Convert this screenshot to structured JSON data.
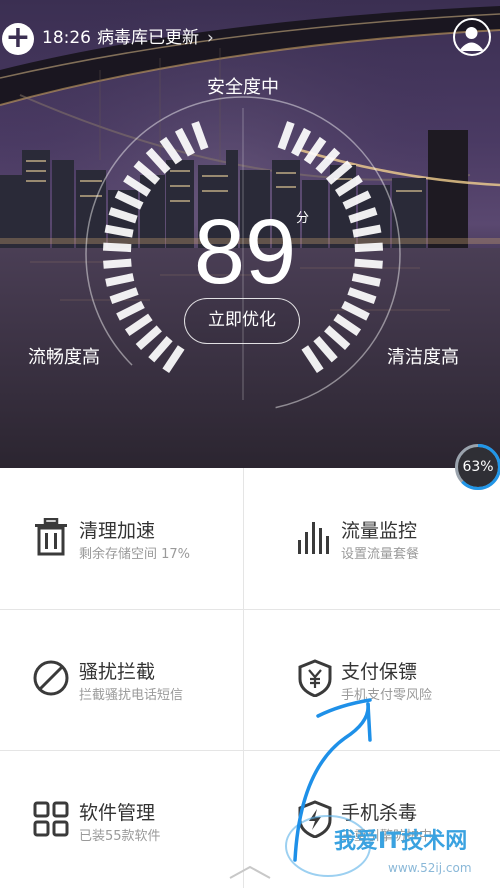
{
  "status": {
    "time": "18:26",
    "message": "病毒库已更新",
    "chevron": "›"
  },
  "hero": {
    "safety_label": "安全度中",
    "score": "89",
    "score_unit": "分",
    "optimize_label": "立即优化",
    "left_label": "流畅度高",
    "right_label": "清洁度高",
    "memory_badge": "63%"
  },
  "tiles": [
    {
      "title": "清理加速",
      "subtitle": "剩余存储空间 17%",
      "icon": "trash-icon"
    },
    {
      "title": "流量监控",
      "subtitle": "设置流量套餐",
      "icon": "bars-icon"
    },
    {
      "title": "骚扰拦截",
      "subtitle": "拦截骚扰电话短信",
      "icon": "block-icon"
    },
    {
      "title": "支付保镖",
      "subtitle": "手机支付零风险",
      "icon": "yen-shield-icon"
    },
    {
      "title": "软件管理",
      "subtitle": "已装55款软件",
      "icon": "grid-icon"
    },
    {
      "title": "手机杀毒",
      "subtitle": "三重引擎防护中",
      "icon": "bolt-shield-icon"
    }
  ],
  "watermark": {
    "line1": "我爱IT技术网",
    "line2": "www.52ij.com"
  },
  "colors": {
    "accent_blue": "#2196e8",
    "tile_title": "#333333",
    "tile_subtitle": "#9a9a9a"
  }
}
